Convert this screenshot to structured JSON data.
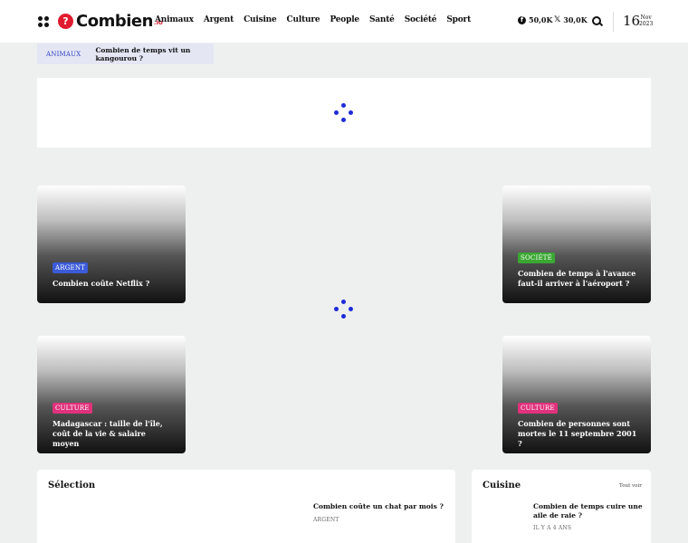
{
  "header": {
    "logo_mark": "?",
    "logo_text": "Combien",
    "logo_tld": ".io",
    "nav": [
      "Animaux",
      "Argent",
      "Cuisine",
      "Culture",
      "People",
      "Santé",
      "Société",
      "Sport"
    ],
    "facebook_icon": "f",
    "facebook_count": "50,0K",
    "x_icon": "𝕏",
    "x_count": "30,0K",
    "date_day": "16",
    "date_month": "Nov",
    "date_year": "2023"
  },
  "ticker": {
    "category": "ANIMAUX",
    "title": "Combien de temps vit un kangourou ?"
  },
  "cards": [
    {
      "category": "ARGENT",
      "category_color": "#3b5bd9",
      "title": "Combien coûte Netflix ?"
    },
    {
      "category": "SOCIÉTÉ",
      "category_color": "#3aa832",
      "title": "Combien de temps à l'avance faut-il arriver à l'aéroport ?"
    },
    {
      "category": "CULTURE",
      "category_color": "#e0327c",
      "title": "Madagascar : taille de l'île, coût de la vie & salaire moyen"
    },
    {
      "category": "CULTURE",
      "category_color": "#e0327c",
      "title": "Combien de personnes sont mortes le 11 septembre 2001 ?"
    }
  ],
  "selection": {
    "title": "Sélection",
    "article_title": "Combien coûte un chat par mois ?",
    "article_category": "ARGENT"
  },
  "cuisine": {
    "title": "Cuisine",
    "link": "Tout voir",
    "article_title": "Combien de temps cuire une aile de raie ?",
    "article_meta": "IL Y A 4 ANS"
  }
}
